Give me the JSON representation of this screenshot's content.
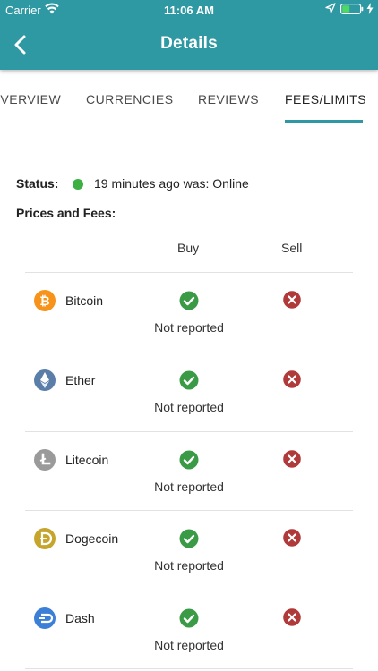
{
  "statusbar": {
    "carrier": "Carrier",
    "time": "11:06 AM"
  },
  "header": {
    "title": "Details"
  },
  "tabs": [
    {
      "label": "OVERVIEW"
    },
    {
      "label": "CURRENCIES"
    },
    {
      "label": "REVIEWS"
    },
    {
      "label": "FEES/LIMITS",
      "active": true
    }
  ],
  "status": {
    "label": "Status:",
    "text": "19 minutes ago was: Online",
    "color": "#3cb043"
  },
  "prices": {
    "label": "Prices and Fees:",
    "buy_header": "Buy",
    "sell_header": "Sell",
    "rows": [
      {
        "name": "Bitcoin",
        "icon": "bitcoin-icon",
        "color": "#f7931a",
        "buy": "check",
        "sell": "cross",
        "note": "Not reported"
      },
      {
        "name": "Ether",
        "icon": "ether-icon",
        "color": "#5b7ea8",
        "buy": "check",
        "sell": "cross",
        "note": "Not reported"
      },
      {
        "name": "Litecoin",
        "icon": "litecoin-icon",
        "color": "#9a9a9a",
        "buy": "check",
        "sell": "cross",
        "note": "Not reported"
      },
      {
        "name": "Dogecoin",
        "icon": "dogecoin-icon",
        "color": "#c6a52d",
        "buy": "check",
        "sell": "cross",
        "note": "Not reported"
      },
      {
        "name": "Dash",
        "icon": "dash-icon",
        "color": "#3b7fd6",
        "buy": "check",
        "sell": "cross",
        "note": "Not reported"
      }
    ]
  },
  "colors": {
    "accent": "#2f99a3",
    "check": "#3a9a45",
    "cross": "#b03a3a"
  }
}
